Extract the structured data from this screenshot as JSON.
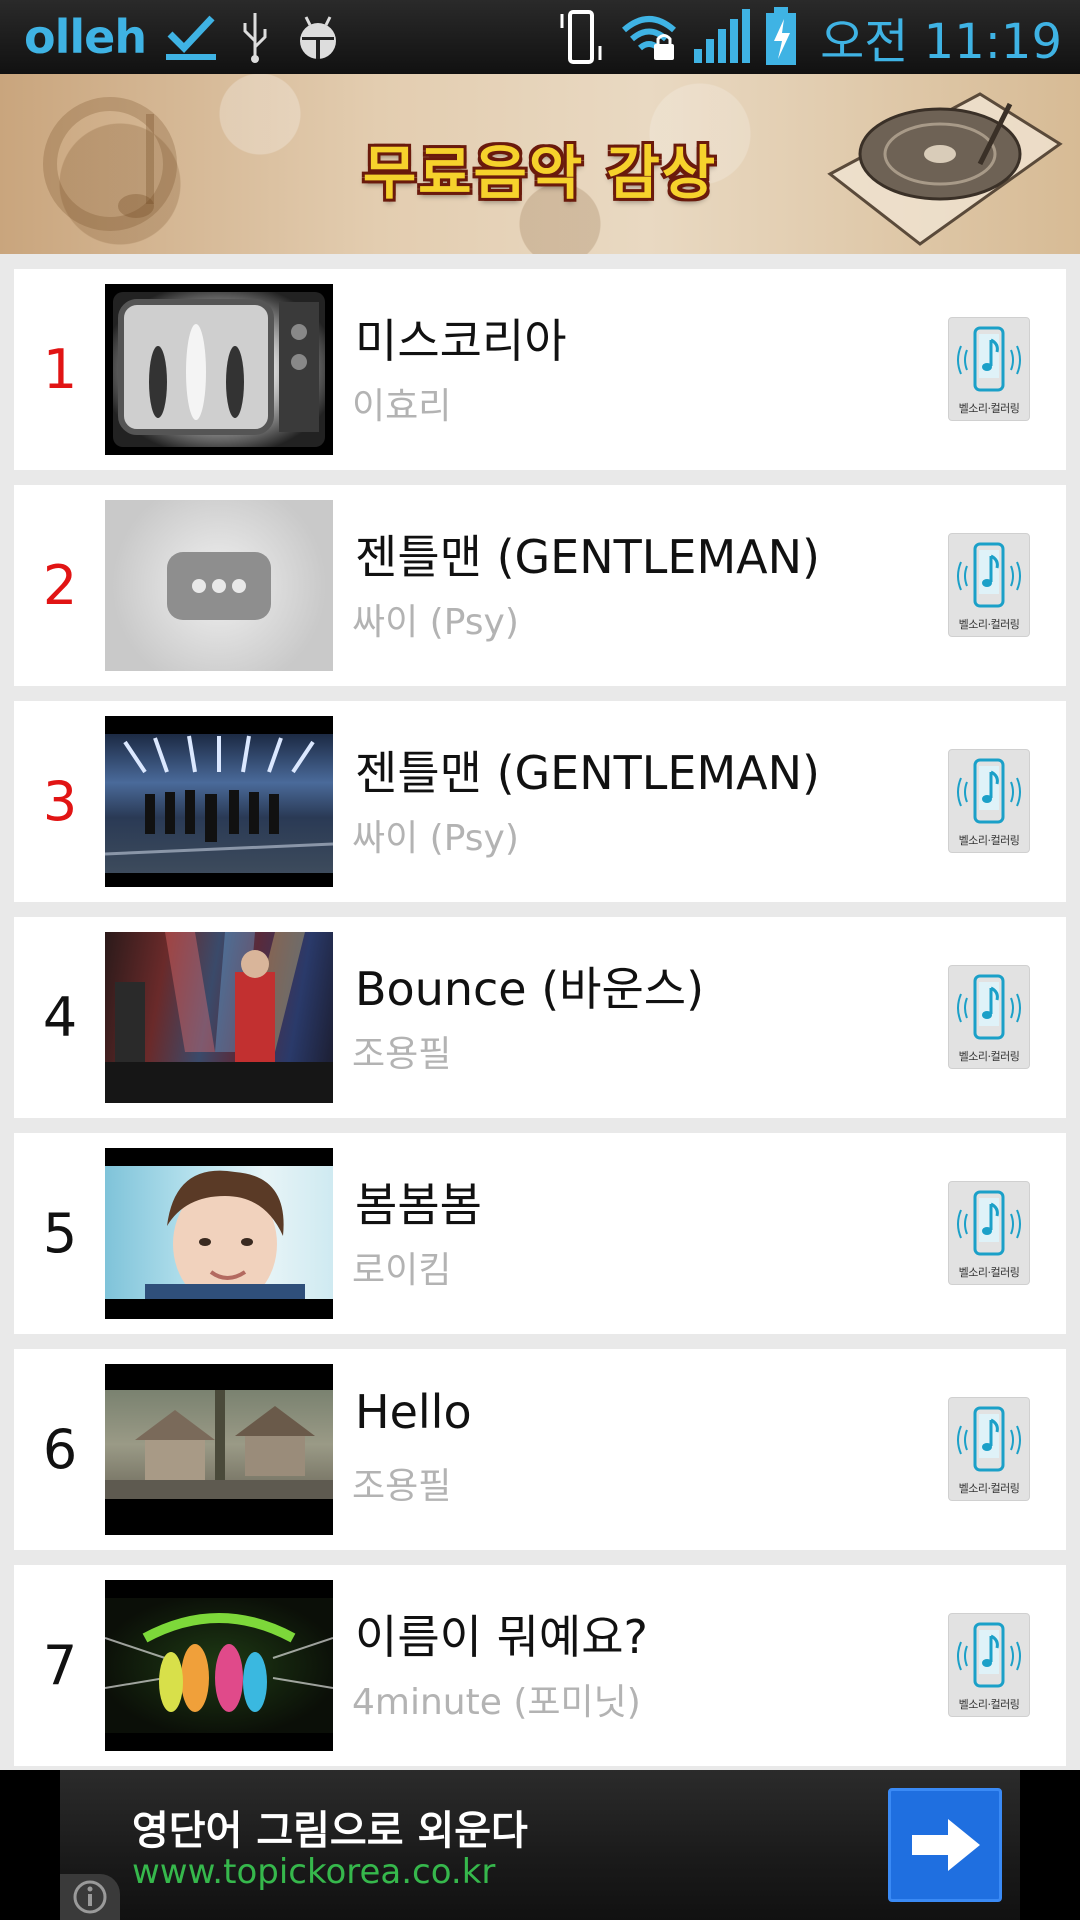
{
  "status_bar": {
    "carrier": "olleh",
    "time": "오전 11:19"
  },
  "banner": {
    "title": "무료음악 감상"
  },
  "ringtone_label": "벨소리·컬러링",
  "songs": [
    {
      "rank": "1",
      "title": "미스코리아",
      "artist": "이효리",
      "highlight": true
    },
    {
      "rank": "2",
      "title": "젠틀맨 (GENTLEMAN)",
      "artist": "싸이 (Psy)",
      "highlight": true
    },
    {
      "rank": "3",
      "title": "젠틀맨 (GENTLEMAN)",
      "artist": "싸이 (Psy)",
      "highlight": true
    },
    {
      "rank": "4",
      "title": "Bounce (바운스)",
      "artist": "조용필",
      "highlight": false
    },
    {
      "rank": "5",
      "title": "봄봄봄",
      "artist": "로이킴",
      "highlight": false
    },
    {
      "rank": "6",
      "title": "Hello",
      "artist": "조용필",
      "highlight": false
    },
    {
      "rank": "7",
      "title": "이름이 뭐예요?",
      "artist": "4minute (포미닛)",
      "highlight": false
    }
  ],
  "ad": {
    "text": "영단어 그림으로 외운다",
    "url": "www.topickorea.co.kr"
  },
  "colors": {
    "accent": "#3fb3e4",
    "rank_highlight": "#e11414",
    "ad_url": "#36b84c",
    "ad_button": "#1f6fe0"
  }
}
